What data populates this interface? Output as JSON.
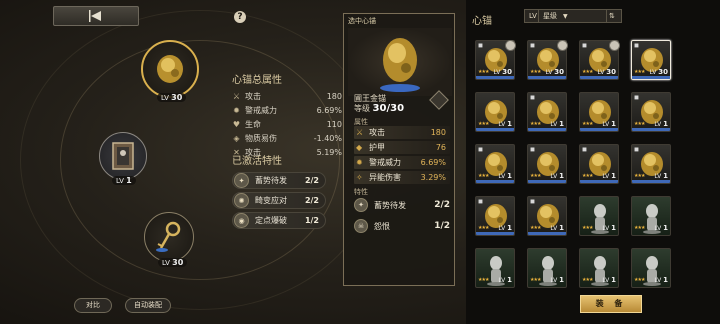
{
  "help_label": "?",
  "anchors": {
    "main": {
      "lv_label": "LV",
      "level": "30"
    },
    "left": {
      "lv_label": "LV",
      "level": "1"
    },
    "bottom": {
      "lv_label": "LV",
      "level": "30"
    }
  },
  "properties": {
    "title": "心锚总属性",
    "rows": [
      {
        "icon": "sword-icon",
        "name": "攻击",
        "value": "180"
      },
      {
        "icon": "alert-icon",
        "name": "警戒威力",
        "value": "6.69%"
      },
      {
        "icon": "heart-icon",
        "name": "生命",
        "value": "110"
      },
      {
        "icon": "shield-icon",
        "name": "物质易伤",
        "value": "-1.40%"
      },
      {
        "icon": "cross-swords-icon",
        "name": "攻击",
        "value": "5.19%"
      }
    ]
  },
  "skills": {
    "title": "已激活特性",
    "items": [
      {
        "name": "蓄势待发",
        "level": "2/2"
      },
      {
        "name": "畸变应对",
        "level": "2/2"
      },
      {
        "name": "定点爆破",
        "level": "1/2"
      }
    ]
  },
  "detail": {
    "header": "选中心锚",
    "name": "圃王金锚",
    "level_label": "等级",
    "level": "30/30",
    "attr_title": "属性",
    "attrs": [
      {
        "name": "攻击",
        "value": "180"
      },
      {
        "name": "护甲",
        "value": "76"
      },
      {
        "name": "警戒威力",
        "value": "6.69%"
      },
      {
        "name": "异能伤害",
        "value": "3.29%"
      }
    ],
    "trait_title": "特性",
    "traits": [
      {
        "name": "蓄势待发",
        "level": "2/2"
      },
      {
        "name": "怨恨",
        "level": "1/2"
      }
    ]
  },
  "grid": {
    "title": "心锚",
    "filter_level": "LV",
    "filter_star": "星级",
    "cells": [
      {
        "lv": "30",
        "blue": true,
        "lock": true,
        "sel": false,
        "green": false,
        "kind": "gold"
      },
      {
        "lv": "30",
        "blue": true,
        "lock": true,
        "sel": false,
        "green": false,
        "kind": "gold"
      },
      {
        "lv": "30",
        "blue": true,
        "lock": true,
        "sel": false,
        "green": false,
        "kind": "gold"
      },
      {
        "lv": "30",
        "blue": true,
        "lock": true,
        "sel": true,
        "green": false,
        "kind": "gold"
      },
      {
        "lv": "1",
        "blue": true,
        "lock": false,
        "sel": false,
        "green": false,
        "kind": "gold"
      },
      {
        "lv": "1",
        "blue": true,
        "lock": true,
        "sel": false,
        "green": false,
        "kind": "gold"
      },
      {
        "lv": "1",
        "blue": true,
        "lock": false,
        "sel": false,
        "green": false,
        "kind": "gold"
      },
      {
        "lv": "1",
        "blue": true,
        "lock": true,
        "sel": false,
        "green": false,
        "kind": "gold"
      },
      {
        "lv": "1",
        "blue": true,
        "lock": true,
        "sel": false,
        "green": false,
        "kind": "gold"
      },
      {
        "lv": "1",
        "blue": true,
        "lock": true,
        "sel": false,
        "green": false,
        "kind": "gold"
      },
      {
        "lv": "1",
        "blue": true,
        "lock": true,
        "sel": false,
        "green": false,
        "kind": "gold"
      },
      {
        "lv": "1",
        "blue": true,
        "lock": true,
        "sel": false,
        "green": false,
        "kind": "gold"
      },
      {
        "lv": "1",
        "blue": true,
        "lock": true,
        "sel": false,
        "green": false,
        "kind": "gold"
      },
      {
        "lv": "1",
        "blue": true,
        "lock": true,
        "sel": false,
        "green": false,
        "kind": "gold"
      },
      {
        "lv": "1",
        "blue": false,
        "lock": false,
        "sel": false,
        "green": true,
        "kind": "silver"
      },
      {
        "lv": "1",
        "blue": false,
        "lock": false,
        "sel": false,
        "green": true,
        "kind": "silver"
      },
      {
        "lv": "1",
        "blue": false,
        "lock": false,
        "sel": false,
        "green": true,
        "kind": "silver"
      },
      {
        "lv": "1",
        "blue": false,
        "lock": false,
        "sel": false,
        "green": true,
        "kind": "silver"
      },
      {
        "lv": "1",
        "blue": false,
        "lock": false,
        "sel": false,
        "green": true,
        "kind": "silver"
      },
      {
        "lv": "1",
        "blue": false,
        "lock": false,
        "sel": false,
        "green": true,
        "kind": "silver"
      }
    ]
  },
  "buttons": {
    "equip": "装 备",
    "compare": "对比",
    "auto": "自动装配"
  },
  "colors": {
    "accent_gold": "#e6c271",
    "level_blue": "#3f69b8",
    "value_gold": "#e2b55a"
  }
}
